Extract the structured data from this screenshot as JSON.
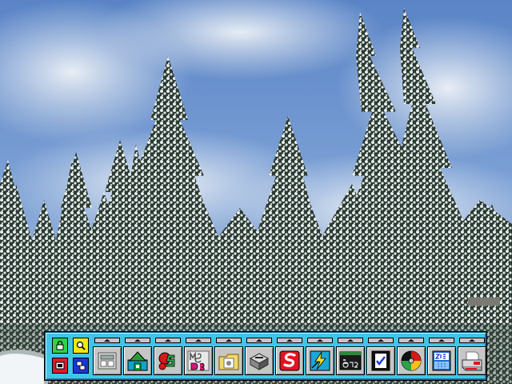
{
  "screen": {
    "wallpaper": "snowy-pine-trees-photo"
  },
  "launchpad": {
    "background_color": "#3fc6e6",
    "mini_buttons": [
      {
        "icon": "lock-icon"
      },
      {
        "icon": "find-icon"
      },
      {
        "icon": "shutdown-icon"
      },
      {
        "icon": "window-list-icon"
      }
    ],
    "objects": [
      {
        "icon": "templates-icon"
      },
      {
        "icon": "os2-system-icon"
      },
      {
        "icon": "os2-window-icon"
      },
      {
        "icon": "dos-window-icon"
      },
      {
        "icon": "drives-folder-icon"
      },
      {
        "icon": "drive-a-icon"
      },
      {
        "icon": "s-program-icon"
      },
      {
        "icon": "lightning-program-icon"
      },
      {
        "icon": "os2-command-prompt-icon"
      },
      {
        "icon": "checklist-icon"
      },
      {
        "icon": "cd-player-icon"
      },
      {
        "icon": "calendar-icon"
      },
      {
        "icon": "printer-icon"
      }
    ]
  }
}
